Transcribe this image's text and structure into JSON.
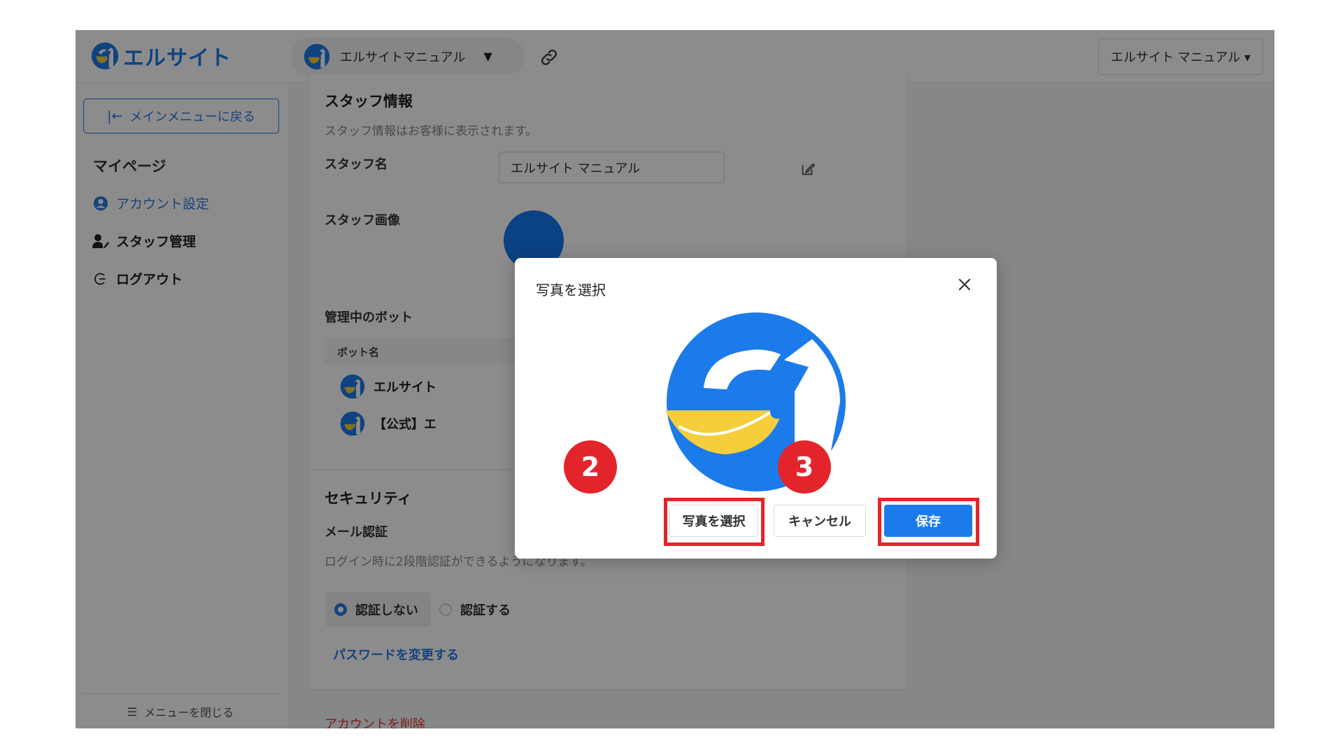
{
  "header": {
    "logo_text": "エルサイト",
    "bot_name": "エルサイトマニュアル",
    "user_name": "エルサイト マニュアル ▾"
  },
  "sidebar": {
    "back_label": "メインメニューに戻る",
    "heading": "マイページ",
    "items": [
      {
        "label": "アカウント設定",
        "icon": "user-circle-icon",
        "active": true
      },
      {
        "label": "スタッフ管理",
        "icon": "staff-icon",
        "active": false
      },
      {
        "label": "ログアウト",
        "icon": "logout-icon",
        "active": false
      }
    ],
    "footer_label": "メニューを閉じる"
  },
  "staff_card": {
    "title": "スタッフ情報",
    "description": "スタッフ情報はお客様に表示されます。",
    "name_label": "スタッフ名",
    "name_value": "エルサイト マニュアル",
    "image_label": "スタッフ画像",
    "bots_title": "管理中のボット",
    "table_header": "ボット名",
    "bots": [
      "エルサイト",
      "【公式】エ"
    ]
  },
  "security_card": {
    "title": "セキュリティ",
    "mail_label": "メール認証",
    "mail_desc": "ログイン時に2段階認証ができるようになります。",
    "options": [
      {
        "label": "認証しない",
        "selected": true
      },
      {
        "label": "認証する",
        "selected": false
      }
    ],
    "password_link": "パスワードを変更する"
  },
  "delete_link": "アカウントを削除",
  "modal": {
    "title": "写真を選択",
    "select_button": "写真を選択",
    "cancel_button": "キャンセル",
    "save_button": "保存"
  },
  "annotations": {
    "badge_select": "2",
    "badge_save": "3",
    "highlight_color": "#e3252b"
  },
  "colors": {
    "brand_blue": "#1c7bea",
    "logo_yellow": "#f6cd3b"
  }
}
